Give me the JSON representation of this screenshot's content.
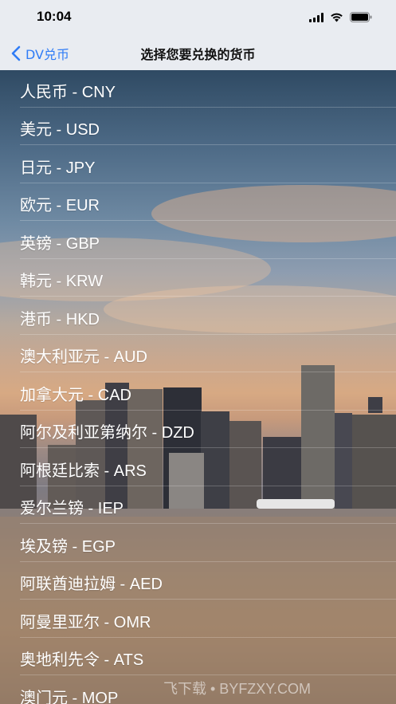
{
  "status_bar": {
    "time": "10:04",
    "icons": [
      "signal-icon",
      "wifi-icon",
      "battery-icon"
    ]
  },
  "nav": {
    "back_label": "DV兑币",
    "title": "选择您要兑换的货币"
  },
  "currencies": [
    {
      "label": "人民币 - CNY"
    },
    {
      "label": "美元 - USD"
    },
    {
      "label": "日元 - JPY"
    },
    {
      "label": "欧元 - EUR"
    },
    {
      "label": "英镑 - GBP"
    },
    {
      "label": "韩元 - KRW"
    },
    {
      "label": "港币 - HKD"
    },
    {
      "label": "澳大利亚元 - AUD"
    },
    {
      "label": "加拿大元 - CAD"
    },
    {
      "label": "阿尔及利亚第纳尔 - DZD"
    },
    {
      "label": "阿根廷比索 - ARS"
    },
    {
      "label": "爱尔兰镑 - IEP"
    },
    {
      "label": "埃及镑 - EGP"
    },
    {
      "label": "阿联酋迪拉姆 - AED"
    },
    {
      "label": "阿曼里亚尔 - OMR"
    },
    {
      "label": "奥地利先令 - ATS"
    },
    {
      "label": "澳门元 - MOP"
    }
  ],
  "watermark": "飞下载 • BYFZXY.COM",
  "colors": {
    "accent": "#2f7cf6",
    "nav_background": "#e9ecf1",
    "list_text": "#ffffff"
  }
}
